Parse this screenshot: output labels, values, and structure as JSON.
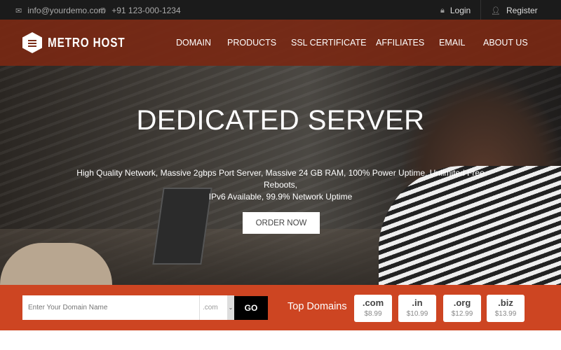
{
  "topbar": {
    "email": "info@yourdemo.com",
    "phone": "+91 123-000-1234",
    "login": "Login",
    "register": "Register"
  },
  "nav": {
    "brand": "METRO HOST",
    "items": [
      "DOMAIN",
      "PRODUCTS",
      "SSL CERTIFICATE",
      "AFFILIATES",
      "EMAIL",
      "ABOUT US"
    ]
  },
  "hero": {
    "title": "DEDICATED SERVER",
    "subtitle_line1": "High Quality Network, Massive 2gbps Port Server, Massive 24 GB RAM, 100% Power Uptime, Unlimited Free Reboots,",
    "subtitle_line2": "IPv6 Available, 99.9% Network Uptime",
    "cta": "ORDER NOW"
  },
  "domain_search": {
    "placeholder": "Enter Your Domain Name",
    "tld_selected": ".com",
    "go": "GO",
    "top_label": "Top Domains",
    "top": [
      {
        "tld": ".com",
        "price": "$8.99"
      },
      {
        "tld": ".in",
        "price": "$10.99"
      },
      {
        "tld": ".org",
        "price": "$12.99"
      },
      {
        "tld": ".biz",
        "price": "$13.99"
      }
    ]
  },
  "colors": {
    "accent": "#cd4522",
    "nav": "#78281a",
    "topbar": "#1b1b1b"
  }
}
